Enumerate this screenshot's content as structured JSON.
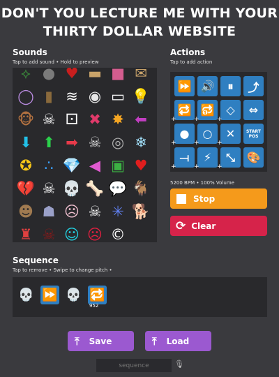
{
  "page_title": "DON'T YOU LECTURE ME WITH YOUR THIRTY DOLLAR WEBSITE",
  "sounds": {
    "heading": "Sounds",
    "hint": "Tap to add sound • Hold to preview",
    "items": [
      {
        "icon": "green-shape-icon",
        "glyph": "⟡",
        "color": "#3c8f3c"
      },
      {
        "icon": "gray-blob-icon",
        "glyph": "●",
        "color": "#7a7a7a"
      },
      {
        "icon": "red-heart-gem-icon",
        "glyph": "♥",
        "color": "#c81e1e"
      },
      {
        "icon": "card-icon",
        "glyph": "▬",
        "color": "#c9a36a"
      },
      {
        "icon": "pink-block-icon",
        "glyph": "■",
        "color": "#d45d8f"
      },
      {
        "icon": "envelope-icon",
        "glyph": "✉",
        "color": "#c9a36a"
      },
      {
        "icon": "purple-orb-icon",
        "glyph": "◯",
        "color": "#b98be0"
      },
      {
        "icon": "brown-bottle-icon",
        "glyph": "▮",
        "color": "#8a6a3c"
      },
      {
        "icon": "spiral-icon",
        "glyph": "≋",
        "color": "#ffffff"
      },
      {
        "icon": "white-disc-icon",
        "glyph": "◉",
        "color": "#e8e8e8"
      },
      {
        "icon": "white-block-icon",
        "glyph": "▭",
        "color": "#ffffff"
      },
      {
        "icon": "lightbulb-icon",
        "glyph": "💡",
        "color": "#ffd23a"
      },
      {
        "icon": "monkey-icon",
        "glyph": "🐵",
        "color": "#b07040"
      },
      {
        "icon": "skeleton-icon",
        "glyph": "☠",
        "color": "#ffffff"
      },
      {
        "icon": "die-icon",
        "glyph": "⚀",
        "color": "#ffffff"
      },
      {
        "icon": "cross-icon",
        "glyph": "✖",
        "color": "#e03a6a"
      },
      {
        "icon": "sun-burst-icon",
        "glyph": "✸",
        "color": "#f5a623"
      },
      {
        "icon": "purple-arrow-left-icon",
        "glyph": "⬅",
        "color": "#c23ec2"
      },
      {
        "icon": "cyan-arrow-down-icon",
        "glyph": "⬇",
        "color": "#22c0e8"
      },
      {
        "icon": "green-arrow-up-icon",
        "glyph": "⬆",
        "color": "#2bd04b"
      },
      {
        "icon": "red-arrow-right-icon",
        "glyph": "➡",
        "color": "#e83a4a"
      },
      {
        "icon": "skull-bones-icon",
        "glyph": "☠",
        "color": "#dddddd"
      },
      {
        "icon": "gray-circle-icon",
        "glyph": "◎",
        "color": "#b0b0b0"
      },
      {
        "icon": "ice-crystal-icon",
        "glyph": "❄",
        "color": "#9fdcf5"
      },
      {
        "icon": "gold-coin-icon",
        "glyph": "✪",
        "color": "#f5c518"
      },
      {
        "icon": "blue-balls-icon",
        "glyph": "∴",
        "color": "#3aa0ff"
      },
      {
        "icon": "diamond-icon",
        "glyph": "💎",
        "color": "#3acaff"
      },
      {
        "icon": "pink-triangle-icon",
        "glyph": "◀",
        "color": "#e05ad0"
      },
      {
        "icon": "green-monster-icon",
        "glyph": "▣",
        "color": "#3cb043"
      },
      {
        "icon": "red-heart-icon",
        "glyph": "♥",
        "color": "#e01e1e"
      },
      {
        "icon": "broken-heart-icon",
        "glyph": "💔",
        "color": "#d01818"
      },
      {
        "icon": "skeleton-dance-icon",
        "glyph": "☠",
        "color": "#ffffff"
      },
      {
        "icon": "sans-skull-icon",
        "glyph": "💀",
        "color": "#ffffff"
      },
      {
        "icon": "bone-icon",
        "glyph": "🦴",
        "color": "#f0e0c0"
      },
      {
        "icon": "speech-bubble-icon",
        "glyph": "💬",
        "color": "#ffffff"
      },
      {
        "icon": "goat-icon",
        "glyph": "🐐",
        "color": "#ffffff"
      },
      {
        "icon": "photo-face-icon",
        "glyph": "☻",
        "color": "#a07a50"
      },
      {
        "icon": "hooded-figure-icon",
        "glyph": "☗",
        "color": "#9aa0c8"
      },
      {
        "icon": "pink-skull-icon",
        "glyph": "☹",
        "color": "#f0c0d0"
      },
      {
        "icon": "skull-face-icon",
        "glyph": "☠",
        "color": "#ffffff"
      },
      {
        "icon": "blue-bug-icon",
        "glyph": "✳",
        "color": "#6080f0"
      },
      {
        "icon": "white-dog-icon",
        "glyph": "🐕",
        "color": "#ffffff"
      },
      {
        "icon": "red-ghost-icon",
        "glyph": "♜",
        "color": "#e04040"
      },
      {
        "icon": "dark-red-skull-icon",
        "glyph": "☠",
        "color": "#8a1a1a"
      },
      {
        "icon": "cyan-face-icon",
        "glyph": "☺",
        "color": "#22d0e0"
      },
      {
        "icon": "red-face-icon",
        "glyph": "☹",
        "color": "#e02040"
      },
      {
        "icon": "copyright-c-icon",
        "glyph": "©",
        "color": "#ffffff"
      }
    ]
  },
  "actions": {
    "heading": "Actions",
    "hint": "Tap to add action",
    "buttons": [
      {
        "icon": "fast-forward-icon",
        "glyph": "⏩"
      },
      {
        "icon": "volume-icon",
        "glyph": "🔊"
      },
      {
        "icon": "pause-icon",
        "glyph": "⏸"
      },
      {
        "icon": "jump-arrow-icon",
        "glyph": "⤴"
      },
      {
        "icon": "loop-icon",
        "glyph": "🔁"
      },
      {
        "icon": "loop-count-icon",
        "glyph": "🔂"
      },
      {
        "icon": "diamond-outline-icon",
        "glyph": "◇"
      },
      {
        "icon": "swap-horizontal-icon",
        "glyph": "⇔"
      },
      {
        "icon": "filled-circle-icon",
        "glyph": "●"
      },
      {
        "icon": "hollow-circle-icon",
        "glyph": "○"
      },
      {
        "icon": "close-x-icon",
        "glyph": "✕"
      },
      {
        "icon": "start-pos-icon",
        "glyph": "",
        "text": "START POS"
      },
      {
        "icon": "divider-icon",
        "glyph": "⟞"
      },
      {
        "icon": "lightning-icon",
        "glyph": "⚡"
      },
      {
        "icon": "compress-icon",
        "glyph": "⤡"
      },
      {
        "icon": "palette-icon",
        "glyph": "🎨"
      }
    ],
    "plus": "+"
  },
  "status": "5200 BPM • 100% Volume",
  "stop_label": "Stop",
  "clear_label": "Clear",
  "sequence": {
    "heading": "Sequence",
    "hint": "Tap to remove • Swipe to change pitch •",
    "items": [
      {
        "icon": "sans-skull-icon",
        "glyph": "💀",
        "color": "#ffffff",
        "type": "sound"
      },
      {
        "icon": "fast-forward-icon",
        "glyph": "⏩",
        "type": "action",
        "value": ""
      },
      {
        "icon": "sans-skull-icon",
        "glyph": "💀",
        "color": "#ffffff",
        "type": "sound"
      },
      {
        "icon": "loop-icon",
        "glyph": "🔁",
        "type": "action",
        "value": "952"
      }
    ]
  },
  "save_label": "Save",
  "load_label": "Load",
  "sequence_field_placeholder": "sequence",
  "colors": {
    "background": "#3a3a3e",
    "panel": "#29292c",
    "action_blue": "#2f7fc1",
    "stop_orange": "#f59a1b",
    "clear_red": "#d6234a",
    "save_purple": "#9b59d0"
  }
}
